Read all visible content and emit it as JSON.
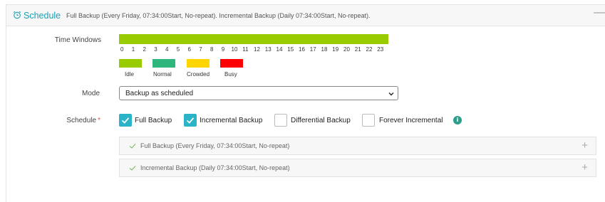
{
  "header": {
    "title": "Schedule",
    "summary": "Full Backup (Every Friday, 07:34:00Start, No-repeat). Incremental Backup (Daily 07:34:00Start, No-repeat).",
    "collapse_glyph": "—",
    "icon": "alarm-clock-icon"
  },
  "time_windows": {
    "label": "Time Windows",
    "hours": [
      "0",
      "1",
      "2",
      "3",
      "4",
      "5",
      "6",
      "7",
      "8",
      "9",
      "10",
      "11",
      "12",
      "13",
      "14",
      "15",
      "16",
      "17",
      "18",
      "19",
      "20",
      "21",
      "22",
      "23"
    ],
    "current_level": "Idle",
    "legend": [
      {
        "label": "Idle",
        "color": "#99cc00"
      },
      {
        "label": "Normal",
        "color": "#2eb67d"
      },
      {
        "label": "Crowded",
        "color": "#ffd500"
      },
      {
        "label": "Busy",
        "color": "#ff0000"
      }
    ]
  },
  "mode": {
    "label": "Mode",
    "value": "Backup as scheduled"
  },
  "schedule": {
    "label": "Schedule",
    "required_mark": "*",
    "options": [
      {
        "label": "Full Backup",
        "checked": true
      },
      {
        "label": "Incremental Backup",
        "checked": true
      },
      {
        "label": "Differential Backup",
        "checked": false
      },
      {
        "label": "Forever Incremental",
        "checked": false
      }
    ],
    "info_glyph": "i",
    "items": [
      {
        "text": "Full Backup (Every Friday, 07:34:00Start, No-repeat)"
      },
      {
        "text": "Incremental Backup (Daily 07:34:00Start, No-repeat)"
      }
    ],
    "add_glyph": "+"
  },
  "colors": {
    "accent": "#2bb3c8",
    "title": "#1aa0b4",
    "info": "#2c9e8a"
  }
}
